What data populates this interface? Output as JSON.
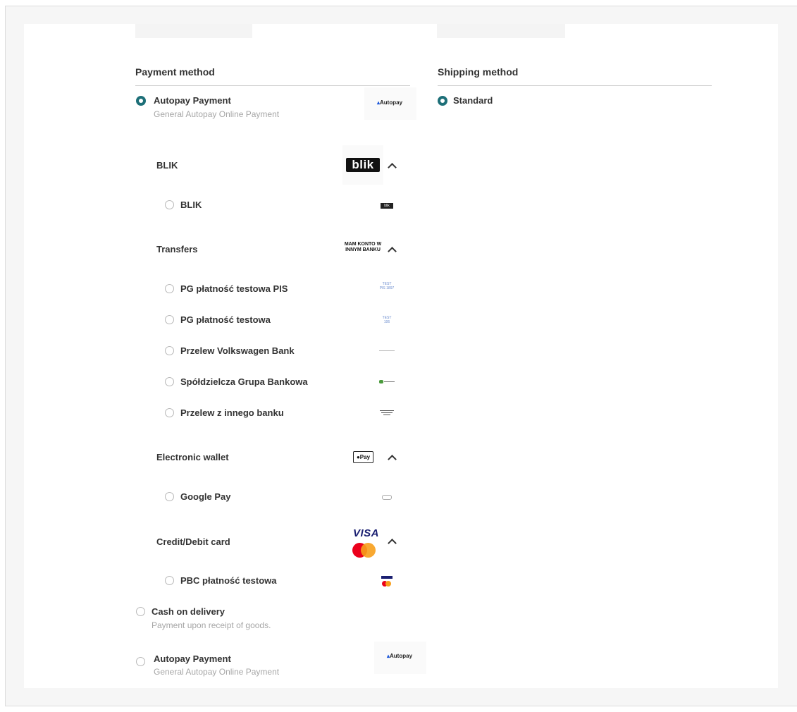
{
  "payment": {
    "title": "Payment method",
    "methods": [
      {
        "label": "Autopay Payment",
        "description": "General Autopay Online Payment",
        "logo": "Autopay",
        "selected": true
      },
      {
        "label": "Cash on delivery",
        "description": "Payment upon receipt of goods.",
        "selected": false
      },
      {
        "label": "Autopay Payment",
        "description": "General Autopay Online Payment",
        "logo": "Autopay",
        "selected": false
      }
    ],
    "groups": [
      {
        "label": "BLIK",
        "logo_text": "blik",
        "options": [
          {
            "label": "BLIK",
            "logo_text": "blik"
          }
        ]
      },
      {
        "label": "Transfers",
        "logo_text": "MAM KONTO W INNYM BANKU",
        "options": [
          {
            "label": "PG płatność testowa PIS",
            "logo_text": "TEST PIS 1897"
          },
          {
            "label": "PG płatność testowa",
            "logo_text": "TEST 106"
          },
          {
            "label": "Przelew Volkswagen Bank",
            "logo_text": ""
          },
          {
            "label": "Spółdzielcza Grupa Bankowa",
            "logo_text": ""
          },
          {
            "label": "Przelew z innego banku",
            "logo_text": ""
          }
        ]
      },
      {
        "label": "Electronic wallet",
        "logo_text": "Pay",
        "options": [
          {
            "label": "Google Pay",
            "logo_text": ""
          }
        ]
      },
      {
        "label": "Credit/Debit card",
        "logo_text": "VISA",
        "options": [
          {
            "label": "PBC płatność testowa",
            "logo_text": ""
          }
        ]
      }
    ]
  },
  "shipping": {
    "title": "Shipping method",
    "options": [
      {
        "label": "Standard",
        "selected": true
      }
    ]
  },
  "colors": {
    "accent": "#1d6f78",
    "muted_text": "#a6a6a6",
    "visa_blue": "#1a1f71",
    "mc_red": "#eb001b",
    "mc_orange": "#f79e1b"
  },
  "icons": {
    "expand": "chevron-up-icon",
    "radio": "radio-icon"
  }
}
